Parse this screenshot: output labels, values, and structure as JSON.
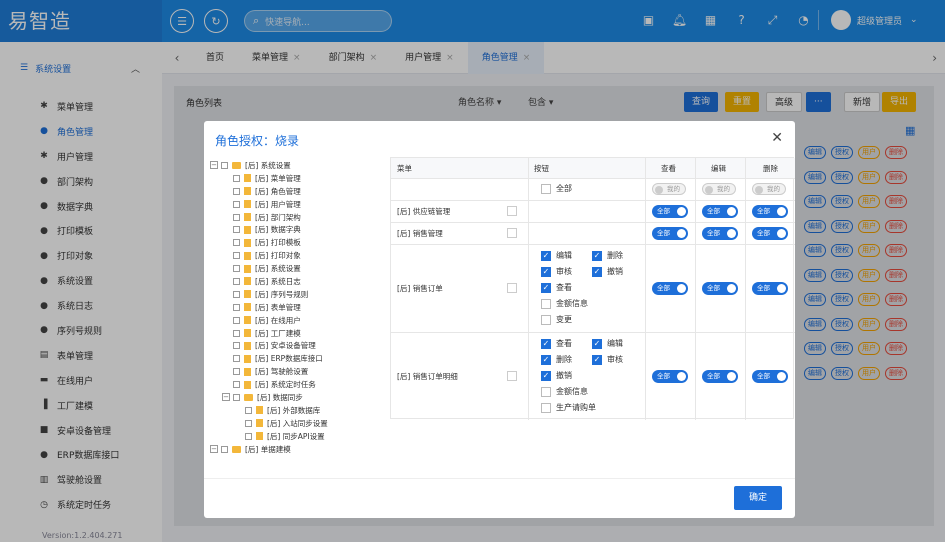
{
  "app": {
    "logo": "易智造",
    "search_placeholder": "快速导航...",
    "user": "超级管理员",
    "version": "Version:1.2.404.271"
  },
  "topicons": [
    "layout-icon",
    "bell-icon",
    "calendar-icon",
    "help-icon",
    "fullscreen-icon",
    "dashboard-icon"
  ],
  "sidebar": {
    "group": "系统设置",
    "items": [
      "菜单管理",
      "角色管理",
      "用户管理",
      "部门架构",
      "数据字典",
      "打印模板",
      "打印对象",
      "系统设置",
      "系统日志",
      "序列号规则",
      "表单管理",
      "在线用户",
      "工厂建模",
      "安卓设备管理",
      "ERP数据库接口",
      "驾驶舱设置",
      "系统定时任务"
    ],
    "active_index": 1
  },
  "tabs": [
    {
      "label": "首页"
    },
    {
      "label": "菜单管理"
    },
    {
      "label": "部门架构"
    },
    {
      "label": "用户管理"
    },
    {
      "label": "角色管理"
    }
  ],
  "content": {
    "title": "角色列表",
    "filter_field": "角色名称",
    "filter_op": "包含",
    "buttons": {
      "query": "查询",
      "reset": "重置",
      "advanced": "高级",
      "more": "···",
      "add": "新增",
      "export": "导出"
    },
    "row_buttons": [
      "编辑",
      "授权",
      "用户",
      "删除"
    ]
  },
  "modal": {
    "title": "角色授权：烧录",
    "ok": "确定",
    "tree": [
      {
        "level": 0,
        "type": "folder",
        "label": "[后] 系统设置",
        "toggle": "−"
      },
      {
        "level": 1,
        "type": "page",
        "label": "[后] 菜单管理"
      },
      {
        "level": 1,
        "type": "page",
        "label": "[后] 角色管理"
      },
      {
        "level": 1,
        "type": "page",
        "label": "[后] 用户管理"
      },
      {
        "level": 1,
        "type": "page",
        "label": "[后] 部门架构"
      },
      {
        "level": 1,
        "type": "page",
        "label": "[后] 数据字典"
      },
      {
        "level": 1,
        "type": "page",
        "label": "[后] 打印模板"
      },
      {
        "level": 1,
        "type": "page",
        "label": "[后] 打印对象"
      },
      {
        "level": 1,
        "type": "page",
        "label": "[后] 系统设置"
      },
      {
        "level": 1,
        "type": "page",
        "label": "[后] 系统日志"
      },
      {
        "level": 1,
        "type": "page",
        "label": "[后] 序列号规则"
      },
      {
        "level": 1,
        "type": "page",
        "label": "[后] 表单管理"
      },
      {
        "level": 1,
        "type": "page",
        "label": "[后] 在线用户"
      },
      {
        "level": 1,
        "type": "page",
        "label": "[后] 工厂建模"
      },
      {
        "level": 1,
        "type": "page",
        "label": "[后] 安卓设备管理"
      },
      {
        "level": 1,
        "type": "page",
        "label": "[后] ERP数据库接口"
      },
      {
        "level": 1,
        "type": "page",
        "label": "[后] 驾驶舱设置"
      },
      {
        "level": 1,
        "type": "page",
        "label": "[后] 系统定时任务"
      },
      {
        "level": 1,
        "type": "folder",
        "label": "[后] 数据同步",
        "toggle": "−"
      },
      {
        "level": 2,
        "type": "page",
        "label": "[后] 外部数据库"
      },
      {
        "level": 2,
        "type": "page",
        "label": "[后] 入站同步设置"
      },
      {
        "level": 2,
        "type": "page",
        "label": "[后] 同步API设置"
      },
      {
        "level": 0,
        "type": "folder",
        "label": "[后] 单据建模",
        "toggle": "−"
      }
    ],
    "grid": {
      "headers": {
        "menu": "菜单",
        "buttons": "按钮",
        "view": "查看",
        "edit": "编辑",
        "delete": "删除"
      },
      "all_label": "全部",
      "mine_label": "我的",
      "rows": [
        {
          "menu": "[后] 供应链管理",
          "view": "全部",
          "edit": "全部",
          "del": "全部"
        },
        {
          "menu": "[后] 销售管理",
          "view": "全部",
          "edit": "全部",
          "del": "全部"
        },
        {
          "menu": "[后] 销售订单",
          "view": "全部",
          "edit": "全部",
          "del": "全部",
          "checks": [
            {
              "label": "编辑",
              "on": true
            },
            {
              "label": "删除",
              "on": true
            },
            {
              "label": "审核",
              "on": true
            },
            {
              "label": "撤销",
              "on": true
            },
            {
              "label": "查看",
              "on": true
            },
            {
              "label": "金额信息",
              "on": false
            },
            {
              "label": "变更",
              "on": false
            }
          ]
        },
        {
          "menu": "[后] 销售订单明细",
          "view": "全部",
          "edit": "全部",
          "del": "全部",
          "checks": [
            {
              "label": "查看",
              "on": true
            },
            {
              "label": "编辑",
              "on": true
            },
            {
              "label": "删除",
              "on": true
            },
            {
              "label": "审核",
              "on": true
            },
            {
              "label": "撤销",
              "on": true
            },
            {
              "label": "金额信息",
              "on": false
            },
            {
              "label": "生产请购单",
              "on": false
            }
          ]
        }
      ]
    }
  }
}
